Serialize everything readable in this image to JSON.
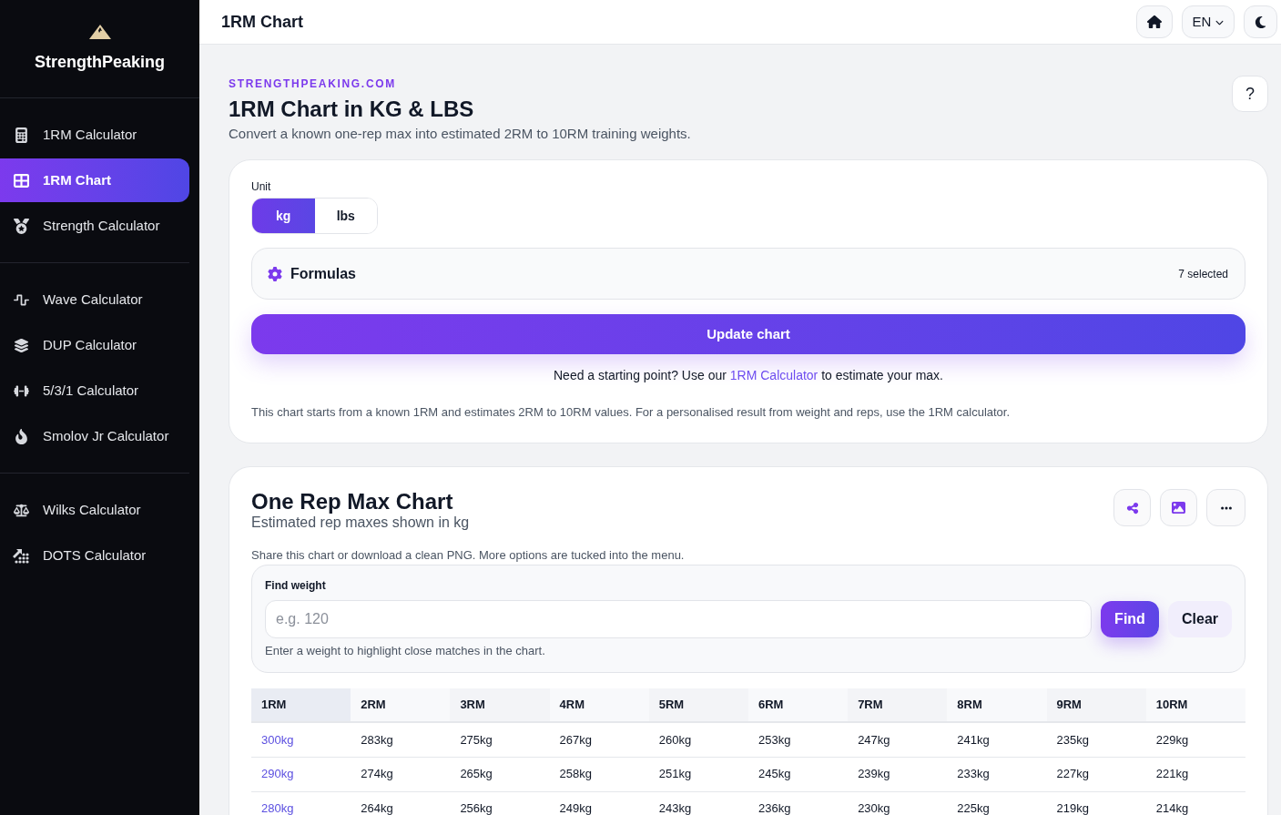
{
  "sidebar": {
    "brand": "StrengthPeaking",
    "groups": [
      {
        "items": [
          {
            "label": "1RM Calculator",
            "selected": false
          },
          {
            "label": "1RM Chart",
            "selected": true
          },
          {
            "label": "Strength Calculator",
            "selected": false
          }
        ]
      },
      {
        "items": [
          {
            "label": "Wave Calculator",
            "selected": false
          },
          {
            "label": "DUP Calculator",
            "selected": false
          },
          {
            "label": "5/3/1 Calculator",
            "selected": false
          },
          {
            "label": "Smolov Jr Calculator",
            "selected": false
          }
        ]
      },
      {
        "items": [
          {
            "label": "Wilks Calculator",
            "selected": false
          },
          {
            "label": "DOTS Calculator",
            "selected": false
          }
        ]
      }
    ]
  },
  "header": {
    "title": "1RM Chart",
    "language": "EN"
  },
  "intro": {
    "eyebrow": "STRENGTHPEAKING.COM",
    "title": "1RM Chart in KG & LBS",
    "subtitle": "Convert a known one-rep max into estimated 2RM to 10RM training weights.",
    "help": "?"
  },
  "settings": {
    "unit_label": "Unit",
    "units": [
      {
        "label": "kg",
        "selected": true
      },
      {
        "label": "lbs",
        "selected": false
      }
    ],
    "formulas": {
      "label": "Formulas",
      "count": "7 selected"
    },
    "update_button": "Update chart",
    "hint": {
      "before": "Need a starting point? Use our",
      "link": "1RM Calculator",
      "after": "to estimate your max."
    },
    "note": "This chart starts from a known 1RM and estimates 2RM to 10RM values. For a personalised result from weight and reps, use the 1RM calculator."
  },
  "chart": {
    "title": "One Rep Max Chart",
    "subtitle": "Estimated rep maxes shown in kg",
    "share_text": "Share this chart or download a clean PNG. More options are tucked into the menu.",
    "find": {
      "label": "Find weight",
      "placeholder": "e.g. 120",
      "find_button": "Find",
      "clear_button": "Clear",
      "hint": "Enter a weight to highlight close matches in the chart."
    },
    "table": {
      "columns": [
        "1RM",
        "2RM",
        "3RM",
        "4RM",
        "5RM",
        "6RM",
        "7RM",
        "8RM",
        "9RM",
        "10RM"
      ],
      "rows": [
        [
          "300kg",
          "283kg",
          "275kg",
          "267kg",
          "260kg",
          "253kg",
          "247kg",
          "241kg",
          "235kg",
          "229kg"
        ],
        [
          "290kg",
          "274kg",
          "265kg",
          "258kg",
          "251kg",
          "245kg",
          "239kg",
          "233kg",
          "227kg",
          "221kg"
        ],
        [
          "280kg",
          "264kg",
          "256kg",
          "249kg",
          "243kg",
          "236kg",
          "230kg",
          "225kg",
          "219kg",
          "214kg"
        ]
      ]
    }
  }
}
